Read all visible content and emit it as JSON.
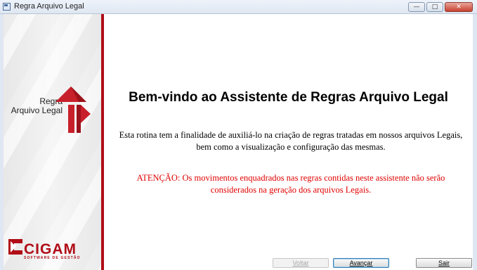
{
  "window": {
    "title": "Regra Arquivo Legal",
    "controls": {
      "minimize": "—",
      "maximize": "□",
      "close": "✕"
    }
  },
  "sidebar": {
    "logo_line1": "Regra",
    "logo_line2": "Arquivo Legal",
    "brand_name": "CIGAM",
    "brand_tagline": "SOFTWARE DE GESTÃO",
    "brand_color": "#b00d17"
  },
  "main": {
    "heading": "Bem-vindo ao Assistente de Regras Arquivo Legal",
    "description": "Esta rotina tem a finalidade de auxiliá-lo na criação de regras tratadas em nossos arquivos Legais, bem como a visualização e configuração das mesmas.",
    "warning": "ATENÇÃO: Os movimentos enquadrados nas regras contidas neste assistente não serão considerados na geração dos arquivos Legais.",
    "warning_color": "#e00000"
  },
  "buttons": {
    "back": "Voltar",
    "next": "Avançar",
    "exit": "Sair"
  }
}
